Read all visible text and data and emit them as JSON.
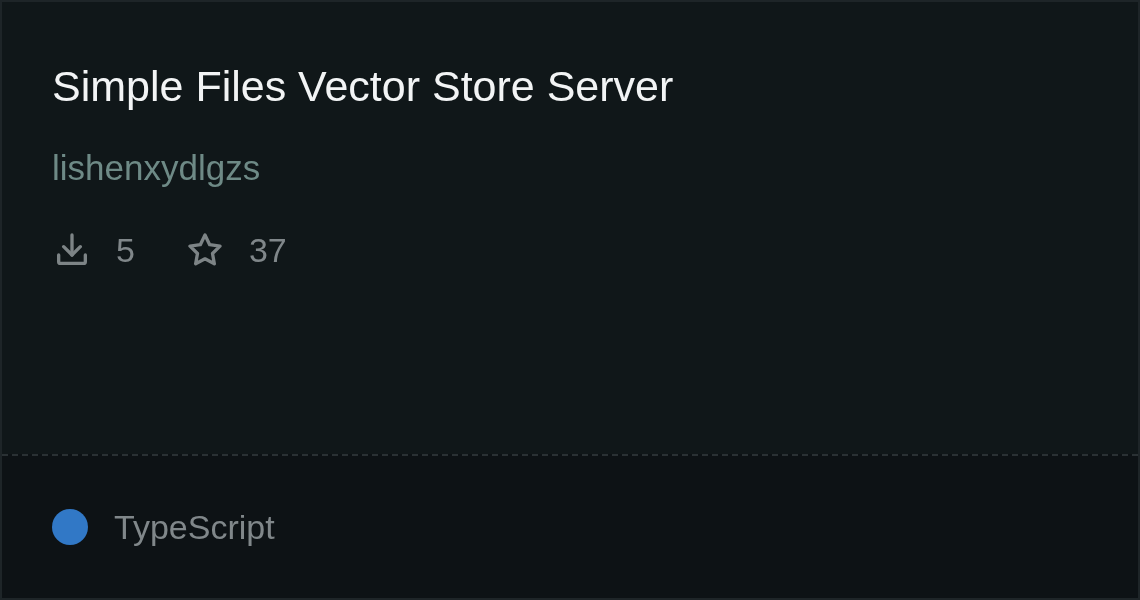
{
  "card": {
    "title": "Simple Files Vector Store Server",
    "author": "lishenxydlgzs",
    "stats": [
      {
        "kind": "downloads",
        "value": "5"
      },
      {
        "kind": "stars",
        "value": "37"
      }
    ],
    "language": {
      "name": "TypeScript",
      "color": "#3178c6"
    }
  }
}
